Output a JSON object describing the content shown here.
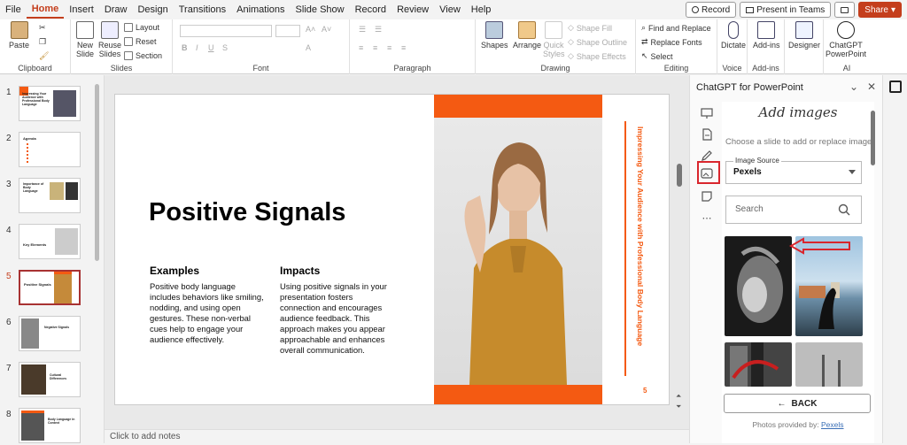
{
  "menu": {
    "tabs": [
      "File",
      "Home",
      "Insert",
      "Draw",
      "Design",
      "Transitions",
      "Animations",
      "Slide Show",
      "Record",
      "Review",
      "View",
      "Help"
    ],
    "active": "Home",
    "record_label": "Record",
    "present_label": "Present in Teams",
    "share_label": "Share"
  },
  "ribbon": {
    "clipboard": {
      "label": "Clipboard",
      "paste": "Paste"
    },
    "slides": {
      "label": "Slides",
      "new_slide": "New Slide",
      "reuse": "Reuse Slides",
      "layout": "Layout",
      "reset": "Reset",
      "section": "Section"
    },
    "font": {
      "label": "Font"
    },
    "paragraph": {
      "label": "Paragraph"
    },
    "drawing": {
      "label": "Drawing",
      "shapes": "Shapes",
      "arrange": "Arrange",
      "quick_styles": "Quick Styles",
      "shape_fill": "Shape Fill",
      "shape_outline": "Shape Outline",
      "shape_effects": "Shape Effects"
    },
    "editing": {
      "label": "Editing",
      "find_replace": "Find and Replace",
      "replace_fonts": "Replace Fonts",
      "select": "Select"
    },
    "voice": {
      "label": "Voice",
      "dictate": "Dictate"
    },
    "addins": {
      "label": "Add-ins",
      "addins": "Add-ins"
    },
    "designer": {
      "designer": "Designer"
    },
    "ai": {
      "label": "AI",
      "chatgpt": "ChatGPT PowerPoint"
    }
  },
  "thumbnails": {
    "items": [
      {
        "num": "1",
        "text": "Impressing Your Audience with Professional Body Language"
      },
      {
        "num": "2",
        "text": "Agenda"
      },
      {
        "num": "3",
        "text": "Importance of Body Language"
      },
      {
        "num": "4",
        "text": "Key Elements"
      },
      {
        "num": "5",
        "text": "Positive Signals"
      },
      {
        "num": "6",
        "text": "Negative Signals"
      },
      {
        "num": "7",
        "text": "Cultural Differences"
      },
      {
        "num": "8",
        "text": "Body Language in Context"
      }
    ],
    "selected_index": 4
  },
  "slide": {
    "title": "Positive Signals",
    "examples_head": "Examples",
    "examples_body": "Positive body language includes behaviors like smiling, nodding, and using open gestures. These non-verbal cues help to engage your audience effectively.",
    "impacts_head": "Impacts",
    "impacts_body": "Using positive signals in your presentation fosters connection and encourages audience feedback. This approach makes you appear approachable and enhances overall communication.",
    "side_text": "Impressing Your Audience with Professional Body Language",
    "page_number": "5",
    "accent": "#f45a12"
  },
  "notes": {
    "placeholder": "Click to add notes"
  },
  "pane": {
    "title": "ChatGPT for PowerPoint",
    "heading": "Add images",
    "hint": "Choose a slide to add or replace image",
    "source_label": "Image Source",
    "source_value": "Pexels",
    "search_placeholder": "Search",
    "back_label": "BACK",
    "credit_prefix": "Photos provided by:",
    "credit_link": "Pexels",
    "highlight_color": "#d9262d"
  }
}
